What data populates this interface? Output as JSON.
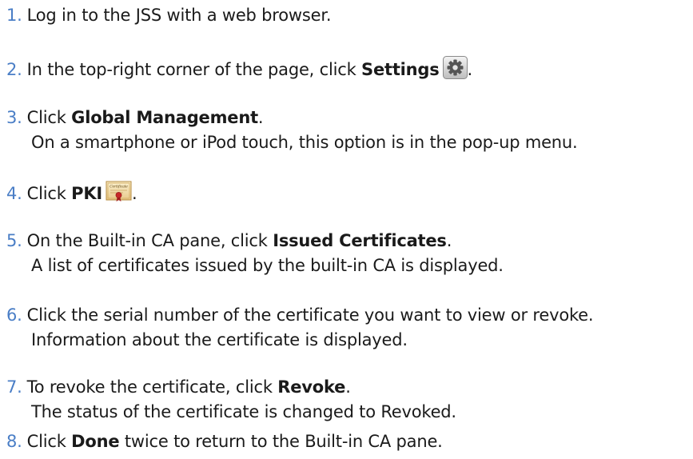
{
  "steps": [
    {
      "number": "1.",
      "text": "Log in to the JSS with a web browser."
    },
    {
      "number": "2.",
      "pre": "In the top-right corner of the page, click ",
      "bold": "Settings",
      "icon": "settings-gear-icon",
      "post": "."
    },
    {
      "number": "3.",
      "pre": "Click ",
      "bold": "Global Management",
      "post": ".",
      "line2": "On a smartphone or iPod touch, this option is in the pop-up menu."
    },
    {
      "number": "4.",
      "pre": "Click ",
      "bold": "PKI",
      "icon": "certificate-icon",
      "icon_caption": "Certificate",
      "post": "."
    },
    {
      "number": "5.",
      "pre": "On the Built-in CA pane, click ",
      "bold": "Issued Certificates",
      "post": ".",
      "line2": "A list of certificates issued by the built-in CA is displayed."
    },
    {
      "number": "6.",
      "text": "Click the serial number of the certificate you want to view or revoke.",
      "line2": "Information about the certificate is displayed."
    },
    {
      "number": "7.",
      "pre": "To revoke the certificate, click ",
      "bold": "Revoke",
      "post": ".",
      "line2": "The status of the certificate is changed to Revoked."
    },
    {
      "number": "8.",
      "pre": "Click ",
      "bold": "Done",
      "post": " twice to return to the Built-in CA pane."
    }
  ],
  "colors": {
    "number": "#4a7ec6",
    "text": "#1a1a1a"
  }
}
